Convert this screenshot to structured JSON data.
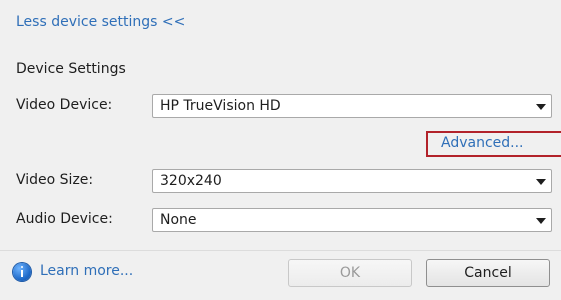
{
  "toggle_link": "Less device settings <<",
  "section_title": "Device Settings",
  "video_device": {
    "label": "Video Device:",
    "value": "HP TrueVision HD"
  },
  "advanced_link": "Advanced...",
  "video_size": {
    "label": "Video Size:",
    "value": "320x240"
  },
  "audio_device": {
    "label": "Audio Device:",
    "value": "None"
  },
  "footer": {
    "learn_more": "Learn more...",
    "ok_label": "OK",
    "cancel_label": "Cancel"
  },
  "colors": {
    "link": "#2f6fb8",
    "highlight_box": "#b2222a",
    "panel_bg": "#f0f0f0"
  },
  "icons": {
    "info": "info-icon",
    "dropdown": "chevron-down-icon"
  },
  "states": {
    "ok_button": "disabled"
  }
}
